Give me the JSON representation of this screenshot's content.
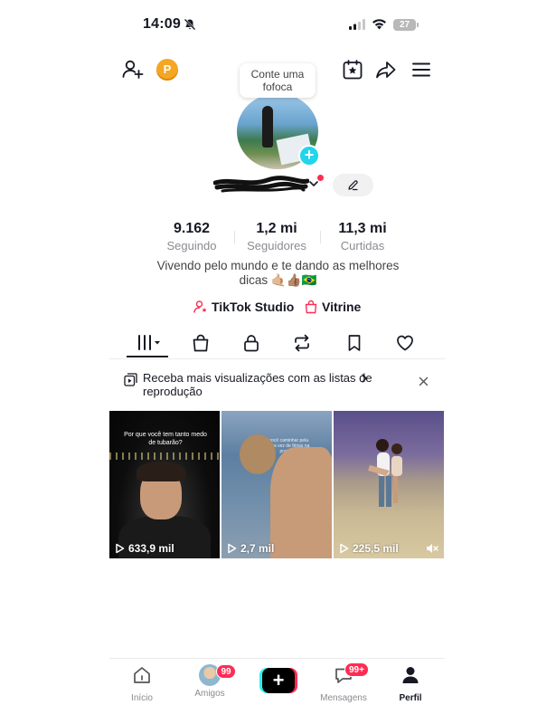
{
  "status_bar": {
    "time": "14:09",
    "battery": "27"
  },
  "header": {
    "coin_label": "P"
  },
  "profile": {
    "note_bubble": "Conte uma fofoca",
    "stats": [
      {
        "value": "9.162",
        "label": "Seguindo"
      },
      {
        "value": "1,2 mi",
        "label": "Seguidores"
      },
      {
        "value": "11,3 mi",
        "label": "Curtidas"
      }
    ],
    "bio_line1": "Vivendo pelo mundo e te dando as melhores",
    "bio_line2": "dicas 🤙🏼👍🏽🇧🇷",
    "links": {
      "studio": "TikTok Studio",
      "vitrine": "Vitrine"
    }
  },
  "playlist_banner": {
    "text": "Receba mais visualizações com as listas de reprodução"
  },
  "videos": [
    {
      "views": "633,9 mil",
      "caption": "Por que você tem tanto medo de tubarão?"
    },
    {
      "views": "2,7 mil",
      "caption": "por você caminhar pela primeira vez de férias na praia"
    },
    {
      "views": "225,5 mil"
    }
  ],
  "bottom_nav": {
    "items": [
      {
        "label": "Início"
      },
      {
        "label": "Amigos",
        "badge": "99"
      },
      {
        "label": ""
      },
      {
        "label": "Mensagens",
        "badge": "99+"
      },
      {
        "label": "Perfil"
      }
    ]
  },
  "colors": {
    "accent": "#fe2c55",
    "cyan": "#25f4ee",
    "text": "#161823",
    "muted": "#8a8b91"
  }
}
